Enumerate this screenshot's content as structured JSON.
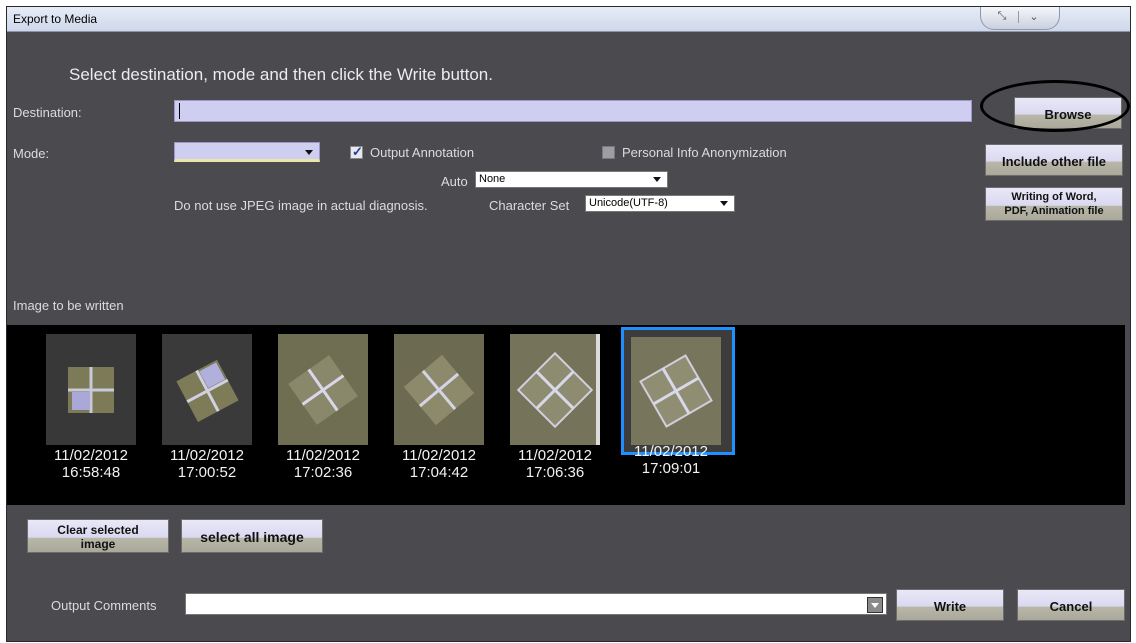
{
  "window": {
    "title": "Export to Media"
  },
  "heading": "Select destination, mode and then click the Write button.",
  "destination": {
    "label": "Destination:",
    "value": ""
  },
  "mode": {
    "label": "Mode:",
    "value": ""
  },
  "output_annotation": {
    "label": "Output Annotation",
    "checked": true
  },
  "personal_info": {
    "label": "Personal Info Anonymization",
    "checked": false
  },
  "auto": {
    "label": "Auto",
    "value": "None"
  },
  "jpeg_note": "Do not use JPEG image in actual diagnosis.",
  "charset": {
    "label": "Character Set",
    "value": "Unicode(UTF-8)"
  },
  "buttons": {
    "browse": "Browse",
    "include_other": "Include other file",
    "writing_line1": "Writing of Word,",
    "writing_line2": "PDF, Animation file",
    "clear_line1": "Clear selected",
    "clear_line2": "image",
    "select_all": "select all image",
    "write": "Write",
    "cancel": "Cancel"
  },
  "images": {
    "label": "Image to be written",
    "items": [
      {
        "date": "11/02/2012",
        "time": "16:58:48",
        "selected": false
      },
      {
        "date": "11/02/2012",
        "time": "17:00:52",
        "selected": false
      },
      {
        "date": "11/02/2012",
        "time": "17:02:36",
        "selected": false
      },
      {
        "date": "11/02/2012",
        "time": "17:04:42",
        "selected": false
      },
      {
        "date": "11/02/2012",
        "time": "17:06:36",
        "selected": false
      },
      {
        "date": "11/02/2012",
        "time": "17:09:01",
        "selected": true
      }
    ]
  },
  "output_comments": {
    "label": "Output Comments",
    "value": ""
  },
  "colors": {
    "background": "#4a4a4f",
    "field": "#cfcdf0",
    "selection": "#1e90ff"
  },
  "icons": {
    "restore": "restore-icon",
    "collapse": "chevron-down-icon",
    "dropdown": "dropdown-arrow-icon"
  }
}
